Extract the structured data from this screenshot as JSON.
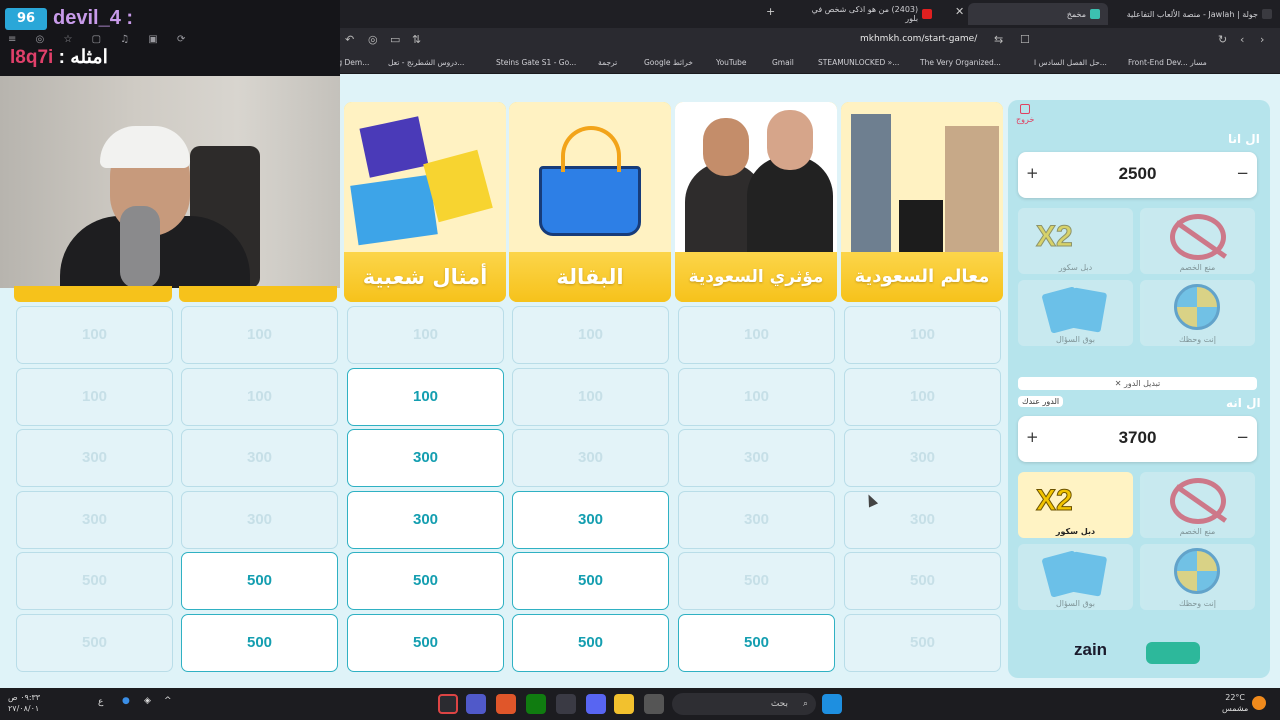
{
  "browser": {
    "tabs": [
      {
        "title": "جولة | Jawlah - منصة الألعاب التفاعلية",
        "active": false
      },
      {
        "title": "مخمخ",
        "active": true
      },
      {
        "title": "(2403) من هو اذكى شخص في بلور",
        "active": false
      }
    ],
    "url": "mkhmkh.com/start-game/",
    "bookmarks": [
      "Quick Trading Dem...",
      "دروس الشطرنج - تعل...",
      "Steins Gate S1 - Go...",
      "ترجمة",
      "Google خرائط",
      "YouTube",
      "Gmail",
      "STEAMUNLOCKED »...",
      "The Very Organized...",
      "حل الفصل السادس ا...",
      "Front-End Dev... مسار"
    ]
  },
  "overlay": {
    "username": "devil_4 :",
    "logo": "96",
    "line2_red": "l8q7i",
    "line2_white": ": امثله"
  },
  "categories": [
    {
      "title": "أمثال شعبية"
    },
    {
      "title": "البقالة"
    },
    {
      "title": "مؤثري السعودية"
    },
    {
      "title": "معالم السعودية"
    }
  ],
  "board": {
    "columns": [
      {
        "cells": [
          {
            "v": "100",
            "open": false
          },
          {
            "v": "100",
            "open": false
          },
          {
            "v": "300",
            "open": false
          },
          {
            "v": "300",
            "open": false
          },
          {
            "v": "500",
            "open": false
          },
          {
            "v": "500",
            "open": false
          }
        ]
      },
      {
        "cells": [
          {
            "v": "100",
            "open": false
          },
          {
            "v": "100",
            "open": false
          },
          {
            "v": "300",
            "open": false
          },
          {
            "v": "300",
            "open": false
          },
          {
            "v": "500",
            "open": true
          },
          {
            "v": "500",
            "open": true
          }
        ]
      },
      {
        "cells": [
          {
            "v": "100",
            "open": false
          },
          {
            "v": "100",
            "open": true
          },
          {
            "v": "300",
            "open": true
          },
          {
            "v": "300",
            "open": true
          },
          {
            "v": "500",
            "open": true
          },
          {
            "v": "500",
            "open": true
          }
        ]
      },
      {
        "cells": [
          {
            "v": "100",
            "open": false
          },
          {
            "v": "100",
            "open": false
          },
          {
            "v": "300",
            "open": false
          },
          {
            "v": "300",
            "open": true
          },
          {
            "v": "500",
            "open": true
          },
          {
            "v": "500",
            "open": true
          }
        ]
      },
      {
        "cells": [
          {
            "v": "100",
            "open": false
          },
          {
            "v": "100",
            "open": false
          },
          {
            "v": "300",
            "open": false
          },
          {
            "v": "300",
            "open": false
          },
          {
            "v": "500",
            "open": false
          },
          {
            "v": "500",
            "open": true
          }
        ]
      },
      {
        "cells": [
          {
            "v": "100",
            "open": false
          },
          {
            "v": "100",
            "open": false
          },
          {
            "v": "300",
            "open": false
          },
          {
            "v": "300",
            "open": false
          },
          {
            "v": "500",
            "open": false
          },
          {
            "v": "500",
            "open": false
          }
        ]
      }
    ]
  },
  "panel": {
    "exit_label": "خروج",
    "team1": {
      "name": "ال انا",
      "score": "2500"
    },
    "team2": {
      "name": "ال انه",
      "score": "3700",
      "turn_badge": "الدور عندك"
    },
    "swap_label": "✕ تبديل الدور",
    "helps": {
      "double": "دبل سكور",
      "block": "منع الخصم",
      "steal": "بوق السؤال",
      "luck": "إنت وحظك",
      "x2_text": "X2"
    },
    "sponsor": "zain"
  },
  "taskbar": {
    "search_placeholder": "بحث",
    "time": "٠٩:٣٣ ص",
    "date": "٢٧/٠٨/٠١",
    "temp": "22°C",
    "weather": "مشمس",
    "lang": "ع"
  }
}
